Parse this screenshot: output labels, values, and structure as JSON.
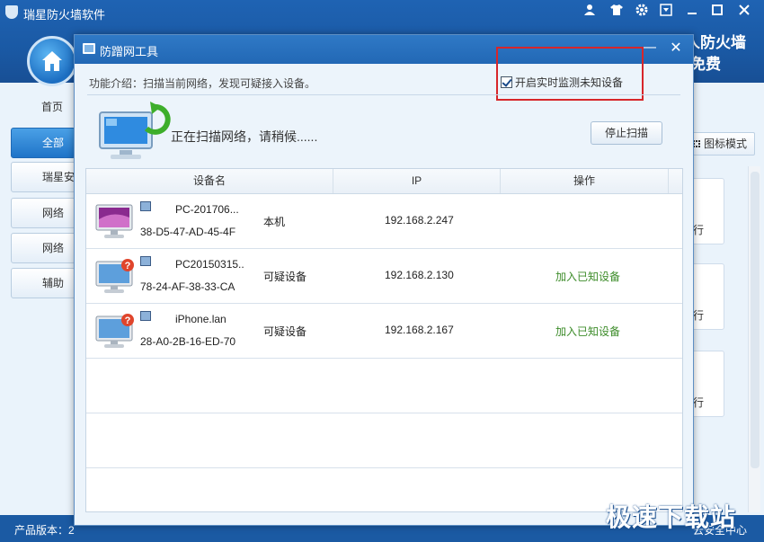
{
  "app": {
    "title": "瑞星防火墙软件",
    "slogan_line1": "人防火墙",
    "slogan_line2": "免费",
    "nav_home": "首页",
    "sidebar": [
      {
        "label": "全部",
        "active": true
      },
      {
        "label": "瑞星安"
      },
      {
        "label": "网络"
      },
      {
        "label": "网络"
      },
      {
        "label": "辅助"
      }
    ],
    "view_toggle": "图标模式",
    "card_action": "行",
    "status_version": "产品版本：2",
    "status_right": "云安全中心"
  },
  "dialog": {
    "title": "防蹭网工具",
    "intro": "功能介绍：扫描当前网络，发现可疑接入设备。",
    "monitor_label": "开启实时监测未知设备",
    "monitor_checked": true,
    "scan_status": "正在扫描网络，请稍候......",
    "stop_button": "停止扫描",
    "columns": [
      "设备名",
      "IP",
      "操作"
    ],
    "devices": [
      {
        "name": "PC-201706...",
        "mac": "38-D5-47-AD-45-4F",
        "type": "本机",
        "ip": "192.168.2.247",
        "action": ""
      },
      {
        "name": "PC20150315..",
        "mac": "78-24-AF-38-33-CA",
        "type": "可疑设备",
        "ip": "192.168.2.130",
        "action": "加入已知设备"
      },
      {
        "name": "iPhone.lan",
        "mac": "28-A0-2B-16-ED-70",
        "type": "可疑设备",
        "ip": "192.168.2.167",
        "action": "加入已知设备"
      }
    ]
  },
  "watermark": "极速下载站",
  "colors": {
    "accent": "#2268b5",
    "action_green": "#3d8c2a",
    "highlight_red": "#d7262a"
  }
}
